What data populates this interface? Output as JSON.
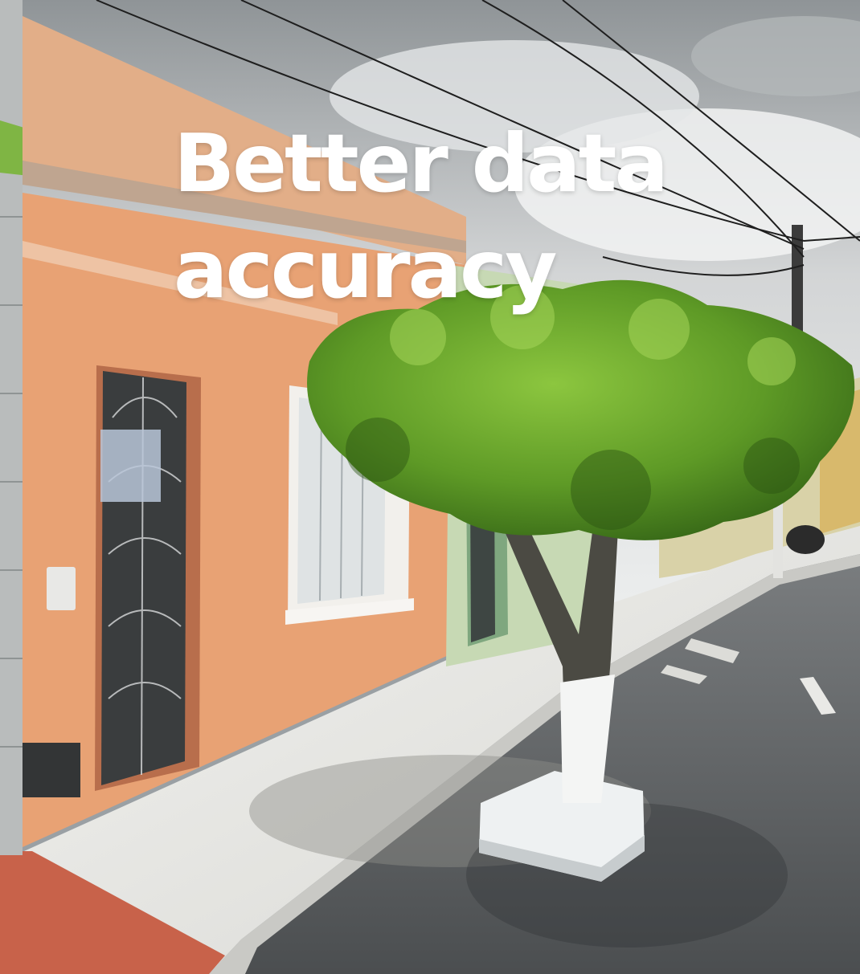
{
  "headline": {
    "line1": "Better data",
    "line2": "accuracy"
  },
  "colors": {
    "sky": "#c9ccce",
    "facade_orange": "#e8a274",
    "sidewalk": "#e6e6e2",
    "asphalt": "#55585a",
    "tree_foliage": "#5e9a26",
    "headline_text": "#ffffff"
  }
}
